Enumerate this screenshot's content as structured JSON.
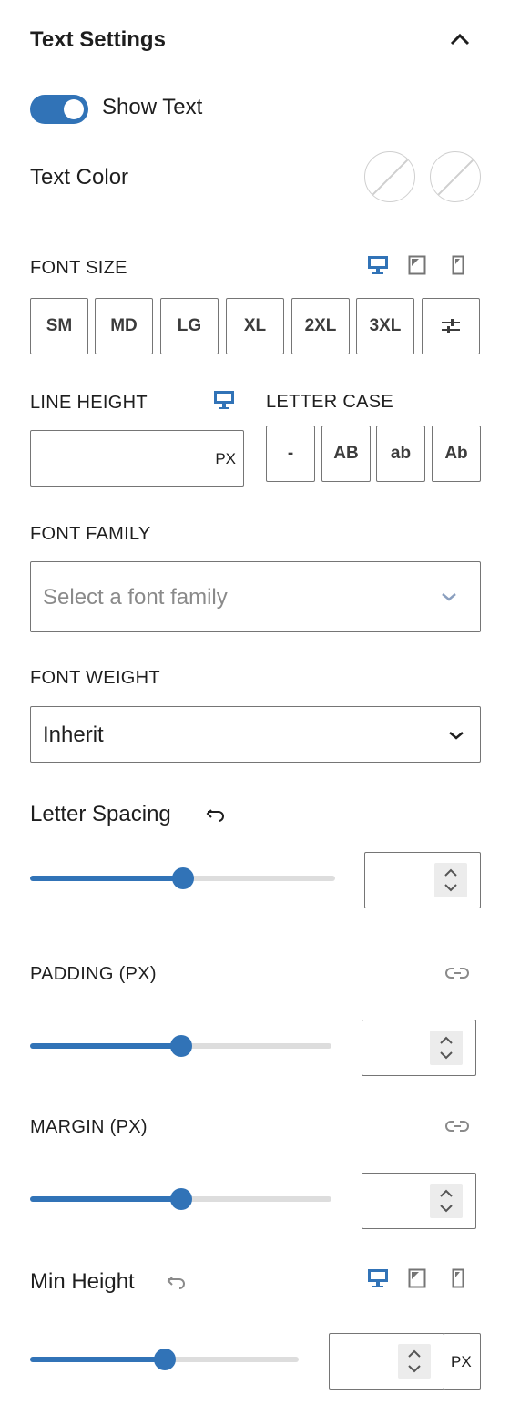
{
  "panel": {
    "title": "Text Settings"
  },
  "show_text": {
    "label": "Show Text",
    "enabled": true
  },
  "text_color": {
    "label": "Text Color"
  },
  "font_size": {
    "label": "FONT SIZE",
    "options": [
      "SM",
      "MD",
      "LG",
      "XL",
      "2XL",
      "3XL"
    ]
  },
  "line_height": {
    "label": "LINE HEIGHT",
    "unit": "PX",
    "value": ""
  },
  "letter_case": {
    "label": "LETTER CASE",
    "options": [
      "-",
      "AB",
      "ab",
      "Ab"
    ]
  },
  "font_family": {
    "label": "FONT FAMILY",
    "placeholder": "Select a font family"
  },
  "font_weight": {
    "label": "FONT WEIGHT",
    "value": "Inherit"
  },
  "letter_spacing": {
    "label": "Letter Spacing",
    "slider_level": 0.5,
    "value": ""
  },
  "padding": {
    "label": "PADDING (PX)",
    "slider_level": 0.5,
    "value": ""
  },
  "margin": {
    "label": "MARGIN (PX)",
    "slider_level": 0.5,
    "value": ""
  },
  "min_height": {
    "label": "Min Height",
    "slider_level": 0.5,
    "value": "",
    "unit": "PX"
  },
  "colors": {
    "accent": "#3173b7",
    "border": "#757575",
    "track": "#dddddd"
  }
}
